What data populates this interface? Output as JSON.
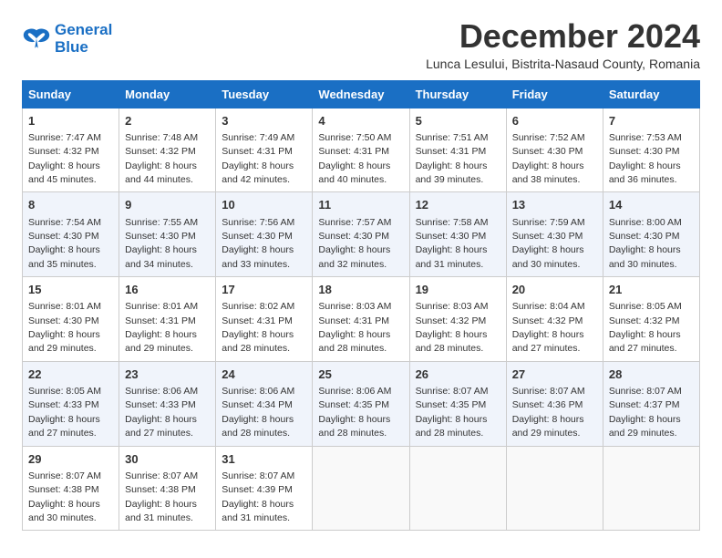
{
  "header": {
    "logo_line1": "General",
    "logo_line2": "Blue",
    "month_title": "December 2024",
    "subtitle": "Lunca Lesului, Bistrita-Nasaud County, Romania"
  },
  "weekdays": [
    "Sunday",
    "Monday",
    "Tuesday",
    "Wednesday",
    "Thursday",
    "Friday",
    "Saturday"
  ],
  "weeks": [
    [
      {
        "day": 1,
        "sunrise": "7:47 AM",
        "sunset": "4:32 PM",
        "daylight": "8 hours and 45 minutes."
      },
      {
        "day": 2,
        "sunrise": "7:48 AM",
        "sunset": "4:32 PM",
        "daylight": "8 hours and 44 minutes."
      },
      {
        "day": 3,
        "sunrise": "7:49 AM",
        "sunset": "4:31 PM",
        "daylight": "8 hours and 42 minutes."
      },
      {
        "day": 4,
        "sunrise": "7:50 AM",
        "sunset": "4:31 PM",
        "daylight": "8 hours and 40 minutes."
      },
      {
        "day": 5,
        "sunrise": "7:51 AM",
        "sunset": "4:31 PM",
        "daylight": "8 hours and 39 minutes."
      },
      {
        "day": 6,
        "sunrise": "7:52 AM",
        "sunset": "4:30 PM",
        "daylight": "8 hours and 38 minutes."
      },
      {
        "day": 7,
        "sunrise": "7:53 AM",
        "sunset": "4:30 PM",
        "daylight": "8 hours and 36 minutes."
      }
    ],
    [
      {
        "day": 8,
        "sunrise": "7:54 AM",
        "sunset": "4:30 PM",
        "daylight": "8 hours and 35 minutes."
      },
      {
        "day": 9,
        "sunrise": "7:55 AM",
        "sunset": "4:30 PM",
        "daylight": "8 hours and 34 minutes."
      },
      {
        "day": 10,
        "sunrise": "7:56 AM",
        "sunset": "4:30 PM",
        "daylight": "8 hours and 33 minutes."
      },
      {
        "day": 11,
        "sunrise": "7:57 AM",
        "sunset": "4:30 PM",
        "daylight": "8 hours and 32 minutes."
      },
      {
        "day": 12,
        "sunrise": "7:58 AM",
        "sunset": "4:30 PM",
        "daylight": "8 hours and 31 minutes."
      },
      {
        "day": 13,
        "sunrise": "7:59 AM",
        "sunset": "4:30 PM",
        "daylight": "8 hours and 30 minutes."
      },
      {
        "day": 14,
        "sunrise": "8:00 AM",
        "sunset": "4:30 PM",
        "daylight": "8 hours and 30 minutes."
      }
    ],
    [
      {
        "day": 15,
        "sunrise": "8:01 AM",
        "sunset": "4:30 PM",
        "daylight": "8 hours and 29 minutes."
      },
      {
        "day": 16,
        "sunrise": "8:01 AM",
        "sunset": "4:31 PM",
        "daylight": "8 hours and 29 minutes."
      },
      {
        "day": 17,
        "sunrise": "8:02 AM",
        "sunset": "4:31 PM",
        "daylight": "8 hours and 28 minutes."
      },
      {
        "day": 18,
        "sunrise": "8:03 AM",
        "sunset": "4:31 PM",
        "daylight": "8 hours and 28 minutes."
      },
      {
        "day": 19,
        "sunrise": "8:03 AM",
        "sunset": "4:32 PM",
        "daylight": "8 hours and 28 minutes."
      },
      {
        "day": 20,
        "sunrise": "8:04 AM",
        "sunset": "4:32 PM",
        "daylight": "8 hours and 27 minutes."
      },
      {
        "day": 21,
        "sunrise": "8:05 AM",
        "sunset": "4:32 PM",
        "daylight": "8 hours and 27 minutes."
      }
    ],
    [
      {
        "day": 22,
        "sunrise": "8:05 AM",
        "sunset": "4:33 PM",
        "daylight": "8 hours and 27 minutes."
      },
      {
        "day": 23,
        "sunrise": "8:06 AM",
        "sunset": "4:33 PM",
        "daylight": "8 hours and 27 minutes."
      },
      {
        "day": 24,
        "sunrise": "8:06 AM",
        "sunset": "4:34 PM",
        "daylight": "8 hours and 28 minutes."
      },
      {
        "day": 25,
        "sunrise": "8:06 AM",
        "sunset": "4:35 PM",
        "daylight": "8 hours and 28 minutes."
      },
      {
        "day": 26,
        "sunrise": "8:07 AM",
        "sunset": "4:35 PM",
        "daylight": "8 hours and 28 minutes."
      },
      {
        "day": 27,
        "sunrise": "8:07 AM",
        "sunset": "4:36 PM",
        "daylight": "8 hours and 29 minutes."
      },
      {
        "day": 28,
        "sunrise": "8:07 AM",
        "sunset": "4:37 PM",
        "daylight": "8 hours and 29 minutes."
      }
    ],
    [
      {
        "day": 29,
        "sunrise": "8:07 AM",
        "sunset": "4:38 PM",
        "daylight": "8 hours and 30 minutes."
      },
      {
        "day": 30,
        "sunrise": "8:07 AM",
        "sunset": "4:38 PM",
        "daylight": "8 hours and 31 minutes."
      },
      {
        "day": 31,
        "sunrise": "8:07 AM",
        "sunset": "4:39 PM",
        "daylight": "8 hours and 31 minutes."
      },
      null,
      null,
      null,
      null
    ]
  ]
}
